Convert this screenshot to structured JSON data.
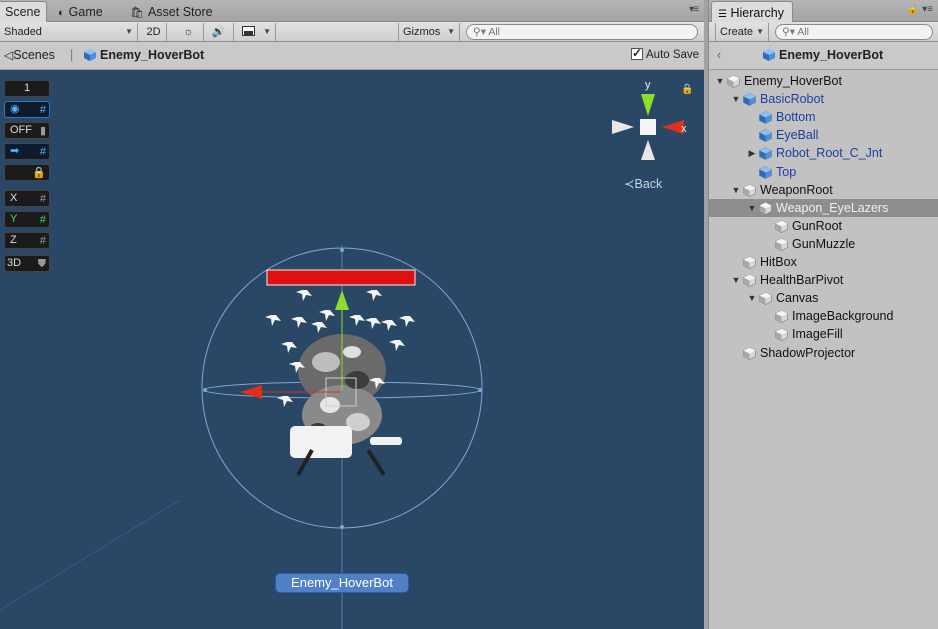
{
  "scene_tabs": {
    "scene": "Scene",
    "game": "Game",
    "asset_store": "Asset Store"
  },
  "scene_toolbar": {
    "shading": "Shaded",
    "mode_2d": "2D",
    "gizmos": "Gizmos",
    "search_placeholder": "All"
  },
  "scene_crumb": {
    "scenes": "Scenes",
    "object": "Enemy_HoverBot",
    "auto_save": "Auto Save"
  },
  "viewport": {
    "layer_number": "1",
    "off_label": "OFF",
    "axis_x": "X",
    "axis_y": "Y",
    "axis_z": "Z",
    "mode_3d": "3D",
    "gizmo_y": "y",
    "gizmo_x": "x",
    "back": "Back",
    "selected_label": "Enemy_HoverBot"
  },
  "hierarchy": {
    "tab": "Hierarchy",
    "create": "Create",
    "search_placeholder": "All",
    "prefab_title": "Enemy_HoverBot",
    "items": [
      {
        "name": "Enemy_HoverBot",
        "depth": 0,
        "expand": "open",
        "prefab": false,
        "selected": false
      },
      {
        "name": "BasicRobot",
        "depth": 1,
        "expand": "open",
        "prefab": true,
        "selected": false
      },
      {
        "name": "Bottom",
        "depth": 2,
        "expand": "none",
        "prefab": true,
        "selected": false
      },
      {
        "name": "EyeBall",
        "depth": 2,
        "expand": "none",
        "prefab": true,
        "selected": false
      },
      {
        "name": "Robot_Root_C_Jnt",
        "depth": 2,
        "expand": "closed",
        "prefab": true,
        "selected": false
      },
      {
        "name": "Top",
        "depth": 2,
        "expand": "none",
        "prefab": true,
        "selected": false
      },
      {
        "name": "WeaponRoot",
        "depth": 1,
        "expand": "open",
        "prefab": false,
        "selected": false
      },
      {
        "name": "Weapon_EyeLazers",
        "depth": 2,
        "expand": "open",
        "prefab": false,
        "selected": true
      },
      {
        "name": "GunRoot",
        "depth": 3,
        "expand": "none",
        "prefab": false,
        "selected": false
      },
      {
        "name": "GunMuzzle",
        "depth": 3,
        "expand": "none",
        "prefab": false,
        "selected": false
      },
      {
        "name": "HitBox",
        "depth": 1,
        "expand": "none",
        "prefab": false,
        "selected": false
      },
      {
        "name": "HealthBarPivot",
        "depth": 1,
        "expand": "open",
        "prefab": false,
        "selected": false
      },
      {
        "name": "Canvas",
        "depth": 2,
        "expand": "open",
        "prefab": false,
        "selected": false
      },
      {
        "name": "ImageBackground",
        "depth": 3,
        "expand": "none",
        "prefab": false,
        "selected": false
      },
      {
        "name": "ImageFill",
        "depth": 3,
        "expand": "none",
        "prefab": false,
        "selected": false
      },
      {
        "name": "ShadowProjector",
        "depth": 1,
        "expand": "none",
        "prefab": false,
        "selected": false
      }
    ]
  },
  "colors": {
    "viewport_bg": "#2a4766",
    "health_bar": "#e01010",
    "gizmo_y": "#8fdc2a",
    "gizmo_x": "#e0301c",
    "selection_label": "#4f80c8",
    "prefab_text": "#1b3ea0"
  }
}
